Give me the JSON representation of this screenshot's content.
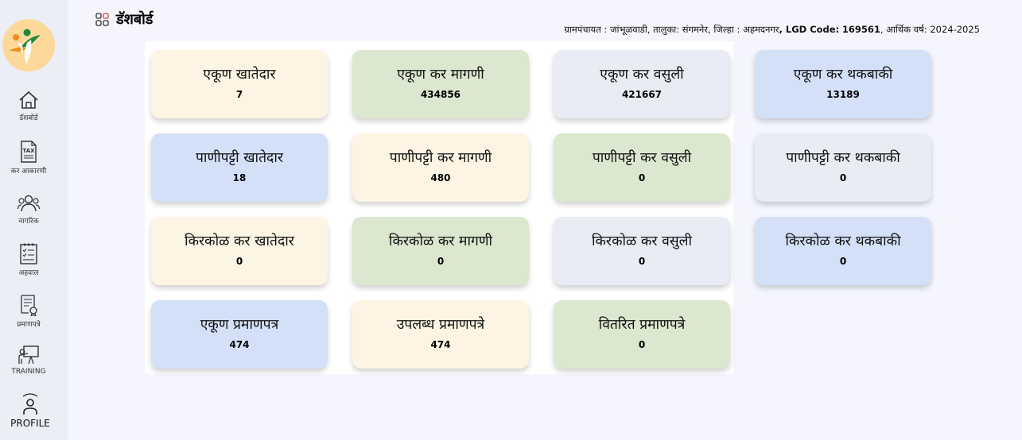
{
  "header": {
    "page_title": "डॅशबोर्ड",
    "gp_label": "ग्रामपंचायत :",
    "gp_value": "जांभूळवाडी",
    "taluka_label": ", तालुका:",
    "taluka_value": "संगमनेर",
    "district_label": ", जिल्हा :",
    "district_value": "अहमदनगर",
    "lgd_label": ", LGD Code:",
    "lgd_value": "169561",
    "year_label": ", आर्थिक वर्ष:",
    "year_value": "2024-2025"
  },
  "sidebar": {
    "items": [
      {
        "label": "डॅशबोर्ड",
        "icon": "home-icon"
      },
      {
        "label": "कर आकारणी",
        "icon": "tax-document-icon"
      },
      {
        "label": "नागरिक",
        "icon": "citizens-icon"
      },
      {
        "label": "अहवाल",
        "icon": "report-icon"
      },
      {
        "label": "प्रमाणपत्रे",
        "icon": "certificate-icon"
      },
      {
        "label": "TRAINING",
        "icon": "training-icon"
      },
      {
        "label": "PROFILE",
        "icon": "profile-icon"
      }
    ]
  },
  "cards": [
    {
      "title": "एकूण खातेदार",
      "value": "7",
      "color": "#fdf4e3"
    },
    {
      "title": "एकूण कर मागणी",
      "value": "434856",
      "color": "#dbe7cf"
    },
    {
      "title": "एकूण कर वसुली",
      "value": "421667",
      "color": "#e9ecf5"
    },
    {
      "title": "एकूण कर थकबाकी",
      "value": "13189",
      "color": "#d4e0f8"
    },
    {
      "title": "पाणीपट्टी खातेदार",
      "value": "18",
      "color": "#d4e0f8"
    },
    {
      "title": "पाणीपट्टी कर मागणी",
      "value": "480",
      "color": "#fdf4e3"
    },
    {
      "title": "पाणीपट्टी कर वसुली",
      "value": "0",
      "color": "#dbe7cf"
    },
    {
      "title": "पाणीपट्टी कर थकबाकी",
      "value": "0",
      "color": "#e9ecf5"
    },
    {
      "title": "किरकोळ कर खातेदार",
      "value": "0",
      "color": "#fdf4e3"
    },
    {
      "title": "किरकोळ कर मागणी",
      "value": "0",
      "color": "#dbe7cf"
    },
    {
      "title": "किरकोळ कर वसुली",
      "value": "0",
      "color": "#e9ecf5"
    },
    {
      "title": "किरकोळ कर थकबाकी",
      "value": "0",
      "color": "#d4e0f8"
    },
    {
      "title": "एकूण प्रमाणपत्र",
      "value": "474",
      "color": "#d4e0f8"
    },
    {
      "title": "उपलब्ध प्रमाणपत्रे",
      "value": "474",
      "color": "#fdf4e3"
    },
    {
      "title": "वितरित प्रमाणपत्रे",
      "value": "0",
      "color": "#dbe7cf"
    }
  ]
}
